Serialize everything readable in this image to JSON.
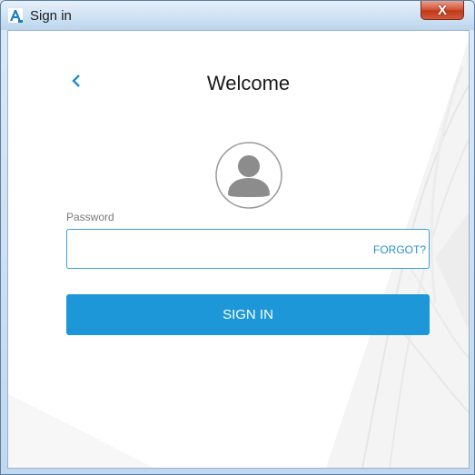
{
  "window": {
    "title": "Sign in",
    "close_label": "X"
  },
  "form": {
    "heading": "Welcome",
    "password_label": "Password",
    "password_value": "",
    "forgot_label": "FORGOT?",
    "signin_label": "SIGN IN"
  },
  "icons": {
    "app": "autodesk-a-icon",
    "back": "chevron-left-icon",
    "avatar": "user-avatar-icon",
    "close": "close-icon"
  },
  "colors": {
    "accent": "#1d97d7",
    "link": "#2a8fc9",
    "close": "#c2391c"
  }
}
